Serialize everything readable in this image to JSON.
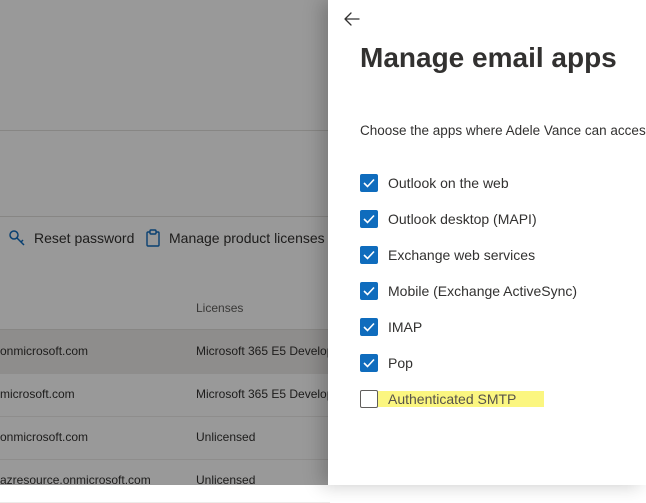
{
  "background": {
    "toolbar": {
      "reset_password": "Reset password",
      "manage_licenses": "Manage product licenses"
    },
    "table": {
      "licenses_header": "Licenses",
      "rows": [
        {
          "user": "onmicrosoft.com",
          "license": "Microsoft 365 E5 Develop"
        },
        {
          "user": "microsoft.com",
          "license": "Microsoft 365 E5 Develop"
        },
        {
          "user": "onmicrosoft.com",
          "license": "Unlicensed"
        },
        {
          "user": "azresource.onmicrosoft.com",
          "license": "Unlicensed"
        }
      ]
    }
  },
  "panel": {
    "title": "Manage email apps",
    "description": "Choose the apps where Adele Vance can access",
    "options": [
      {
        "label": "Outlook on the web",
        "checked": true
      },
      {
        "label": "Outlook desktop (MAPI)",
        "checked": true
      },
      {
        "label": "Exchange web services",
        "checked": true
      },
      {
        "label": "Mobile (Exchange ActiveSync)",
        "checked": true
      },
      {
        "label": "IMAP",
        "checked": true
      },
      {
        "label": "Pop",
        "checked": true
      },
      {
        "label": "Authenticated SMTP",
        "checked": false,
        "highlighted": true
      }
    ]
  },
  "colors": {
    "accent": "#0f6cbd",
    "highlight": "#fbf680",
    "overlay": "rgba(0,0,0,0.40)"
  }
}
